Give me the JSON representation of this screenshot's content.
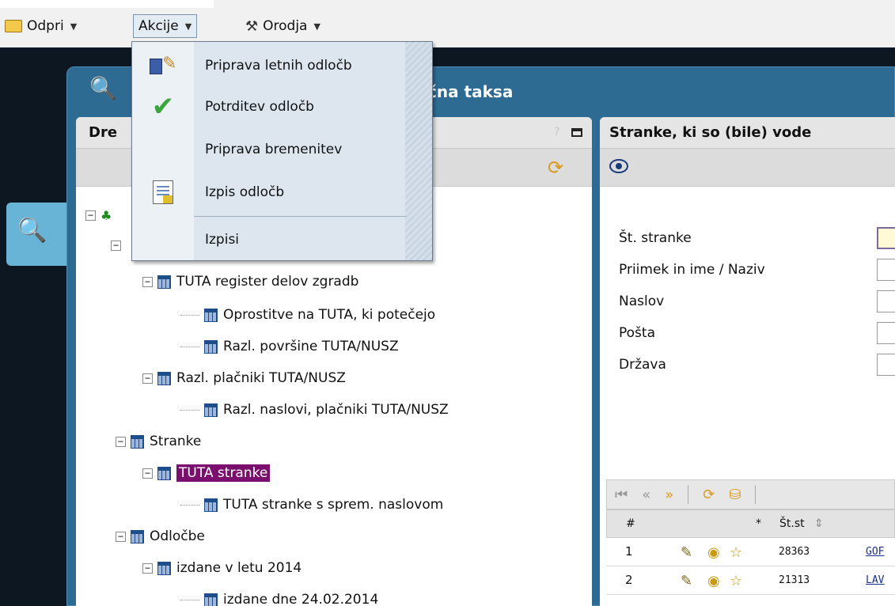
{
  "menubar": {
    "items": [
      {
        "label": "Odpri",
        "icon": "folder-icon"
      },
      {
        "label": "Akcije",
        "icon": ""
      },
      {
        "label": "Orodja",
        "icon": "tools-icon"
      }
    ]
  },
  "dropdown": {
    "items": [
      {
        "label": "Priprava letnih odločb",
        "icon": "calculator-icon"
      },
      {
        "label": "Potrditev odločb",
        "icon": "checkmark-icon"
      },
      {
        "label": "Priprava bremenitev",
        "icon": ""
      },
      {
        "label": "Izpis odločb",
        "icon": "document-icon"
      },
      {
        "label": "Izpisi",
        "icon": ""
      }
    ]
  },
  "window": {
    "title": "čna taksa"
  },
  "left_panel": {
    "title": "Dre",
    "help": "?"
  },
  "tree": {
    "nodes": [
      {
        "label": "TUTA register delov zgradb"
      },
      {
        "label": "Oprostitve na TUTA, ki potečejo"
      },
      {
        "label": "Razl. površine TUTA/NUSZ"
      },
      {
        "label": "Razl. plačniki TUTA/NUSZ"
      },
      {
        "label": "Razl. naslovi, plačniki TUTA/NUSZ"
      },
      {
        "label": "Stranke"
      },
      {
        "label": "TUTA stranke"
      },
      {
        "label": "TUTA stranke s sprem. naslovom"
      },
      {
        "label": "Odločbe"
      },
      {
        "label": "izdane v letu 2014"
      },
      {
        "label": "izdane dne 24.02.2014"
      }
    ]
  },
  "right_panel": {
    "title": "Stranke, ki so (bile) vode",
    "form": {
      "fields": [
        {
          "label": "Št. stranke"
        },
        {
          "label": "Priimek in ime / Naziv"
        },
        {
          "label": "Naslov"
        },
        {
          "label": "Pošta"
        },
        {
          "label": "Država"
        }
      ]
    },
    "grid": {
      "headers": {
        "hash": "#",
        "star": "*",
        "st": "Št.st"
      },
      "rows": [
        {
          "index": "1",
          "number": "28363",
          "name": "GOF"
        },
        {
          "index": "2",
          "number": "21313",
          "name": "LAV"
        }
      ]
    }
  },
  "colors": {
    "selected_bg": "#7a0f6d",
    "window_bg": "#2d6b93",
    "desk_bg": "#0c1722"
  }
}
